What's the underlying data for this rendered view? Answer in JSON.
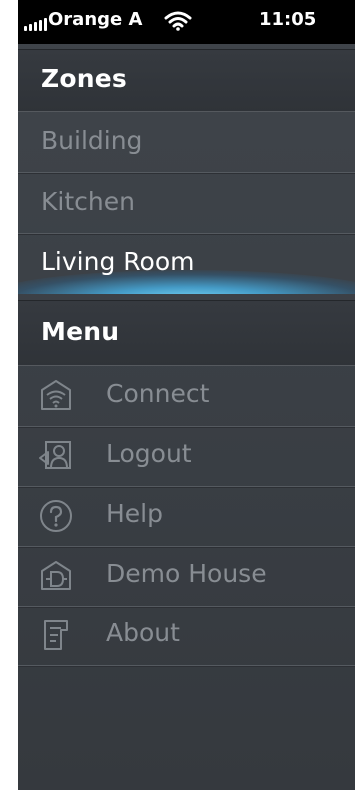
{
  "status_bar": {
    "carrier": "Orange A",
    "time": "11:05"
  },
  "zones": {
    "title": "Zones",
    "items": [
      {
        "label": "Building",
        "active": false
      },
      {
        "label": "Kitchen",
        "active": false
      },
      {
        "label": "Living Room",
        "active": true
      }
    ]
  },
  "menu": {
    "title": "Menu",
    "items": [
      {
        "label": "Connect",
        "icon": "wifi-house-icon"
      },
      {
        "label": "Logout",
        "icon": "logout-person-icon"
      },
      {
        "label": "Help",
        "icon": "question-icon"
      },
      {
        "label": "Demo House",
        "icon": "demo-house-icon"
      },
      {
        "label": "About",
        "icon": "about-document-icon"
      }
    ]
  },
  "colors": {
    "accent_glow": "#78d7fa",
    "active_text": "#ffffff",
    "inactive_text": "#888d93"
  }
}
